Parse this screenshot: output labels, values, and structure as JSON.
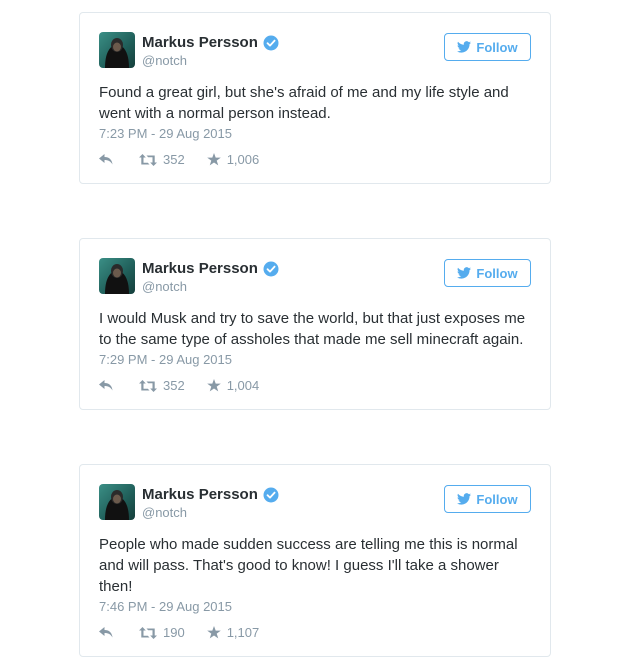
{
  "tweets": [
    {
      "name": "Markus Persson",
      "handle": "@notch",
      "follow_label": "Follow",
      "text": "Found a great girl, but she's afraid of me and my life style and went with a normal person instead.",
      "time": "7:23 PM - 29 Aug 2015",
      "retweets": "352",
      "favorites": "1,006"
    },
    {
      "name": "Markus Persson",
      "handle": "@notch",
      "follow_label": "Follow",
      "text": "I would Musk and try to save the world, but that just exposes me to the same type of assholes that made me sell minecraft again.",
      "time": "7:29 PM - 29 Aug 2015",
      "retweets": "352",
      "favorites": "1,004"
    },
    {
      "name": "Markus Persson",
      "handle": "@notch",
      "follow_label": "Follow",
      "text": "People who made sudden success are telling me this is normal and will pass. That's good to know! I guess I'll take a shower then!",
      "time": "7:46 PM - 29 Aug 2015",
      "retweets": "190",
      "favorites": "1,107"
    }
  ],
  "icons": {
    "verified": "verified-badge-icon",
    "follow": "twitter-bird-icon",
    "reply": "reply-icon",
    "retweet": "retweet-icon",
    "favorite": "star-icon"
  },
  "colors": {
    "twitter_blue": "#55acee",
    "text": "#292f33",
    "muted": "#8899a6",
    "border": "#e1e8ed"
  }
}
